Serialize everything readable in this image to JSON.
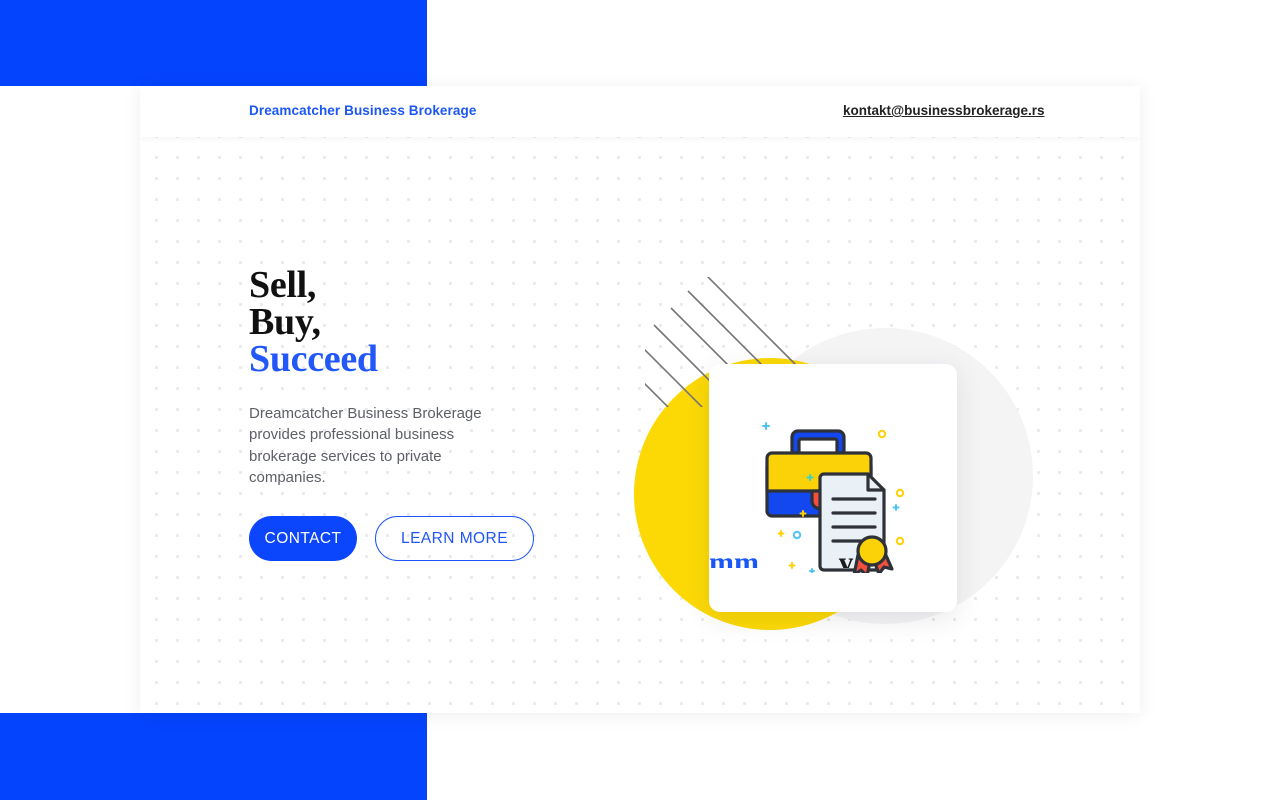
{
  "colors": {
    "brand_blue": "#0544fd",
    "accent_blue": "#2258f7",
    "button_blue": "#0b45fc",
    "yellow": "#fcd905",
    "gray_circle": "#f4f4f5",
    "dot_gray": "#e9e9ec",
    "text_dark": "#111111",
    "body_text": "#5c6066"
  },
  "header": {
    "brand": "Dreamcatcher Business Brokerage",
    "email": "kontakt@businessbrokerage.rs"
  },
  "hero": {
    "headline_line1": "Sell,",
    "headline_line2": "Buy,",
    "headline_line3": "Succeed",
    "paragraph": "Dreamcatcher Business Brokerage provides professional business brokerage services to private companies.",
    "buttons": {
      "primary": "CONTACT",
      "secondary": "LEARN MORE"
    },
    "obscured_text_blue": "mm",
    "obscured_text_dark": "y",
    "illustration": {
      "name": "briefcase-certificate-illustration",
      "parts": [
        "briefcase",
        "document",
        "award-seal",
        "sparkles"
      ]
    }
  },
  "decor": {
    "yellow_circle": "yellow-circle-shape",
    "gray_circle": "gray-circle-shape",
    "diagonal_lines": "diagonal-lines-shape",
    "dot_grid": "dot-grid-pattern",
    "blue_block_top": "blue-block-top",
    "blue_block_bottom": "blue-block-bottom"
  }
}
